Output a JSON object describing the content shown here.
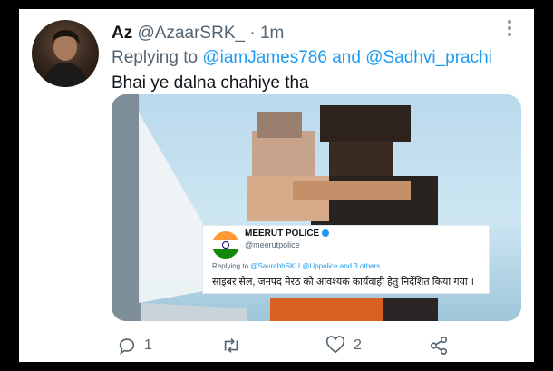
{
  "tweet": {
    "display_name": "Az",
    "handle": "@AzaarSRK_",
    "separator": "·",
    "time": "1m",
    "reply_prefix": "Replying to",
    "reply_user1": "@iamJames786",
    "reply_and": "and",
    "reply_user2": "@Sadhvi_prachi",
    "text": "Bhai ye dalna chahiye tha"
  },
  "quoted": {
    "name": "MEERUT POLICE",
    "handle": "@meerutpolice",
    "reply_prefix": "Replying to",
    "reply_users": "@SaurabhSKU @Uppolice and 3 others",
    "text": "साइबर सेल, जनपद मेरठ को आवश्यक कार्यवाही हेतु निर्देशित किया गया ।"
  },
  "actions": {
    "reply_count": "1",
    "retweet_count": "",
    "like_count": "2"
  },
  "icons": [
    "more-icon",
    "reply-icon",
    "retweet-icon",
    "like-icon",
    "share-icon",
    "verified-icon",
    "avatar",
    "police-logo"
  ],
  "colors": {
    "link": "#1d9bf0",
    "muted": "#536471",
    "text": "#0f1419",
    "background": "#000000"
  }
}
